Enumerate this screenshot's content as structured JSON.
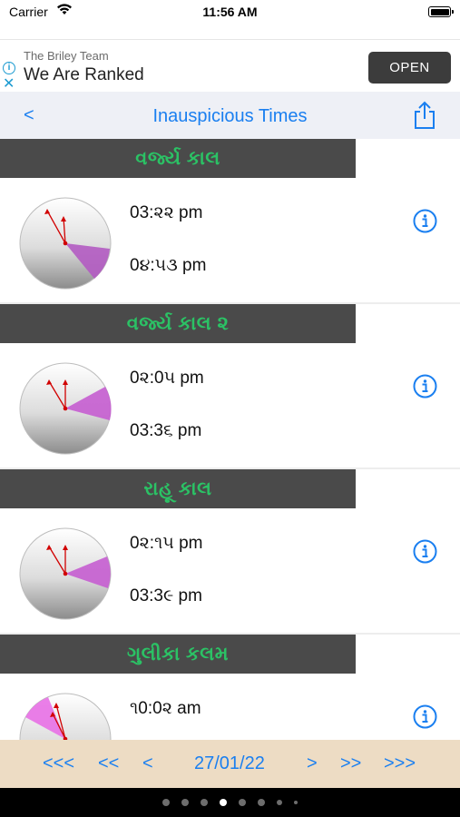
{
  "status_bar": {
    "carrier": "Carrier",
    "time": "11:56 AM"
  },
  "ad": {
    "advertiser": "The Briley Team",
    "headline": "We Are Ranked",
    "cta": "OPEN"
  },
  "nav": {
    "back_label": "<",
    "title": "Inauspicious Times"
  },
  "sections": [
    {
      "title": "વર્જ્ય કાલ",
      "start": "03:૨૨ pm",
      "end": "0૪:૫૩ pm"
    },
    {
      "title": "વર્જ્ય કાલ ૨",
      "start": "0૨:0૫ pm",
      "end": "03:3૬ pm"
    },
    {
      "title": "રાહૂ કાલ",
      "start": "0૨:૧૫ pm",
      "end": "03:3૯ pm"
    },
    {
      "title": "ગુલીકા કલમ",
      "start": "૧0:0૨ am",
      "end": ""
    }
  ],
  "date_nav": {
    "first": "<<<",
    "prev_week": "<<",
    "prev_day": "<",
    "date": "27/01/22",
    "next_day": ">",
    "next_week": ">>",
    "last": ">>>"
  },
  "colors": {
    "accent": "#1a7ff0",
    "header_bg": "#4a4a4a",
    "header_text": "#2bc265",
    "wedge": "#c55dd0",
    "hands": "#d10000"
  }
}
